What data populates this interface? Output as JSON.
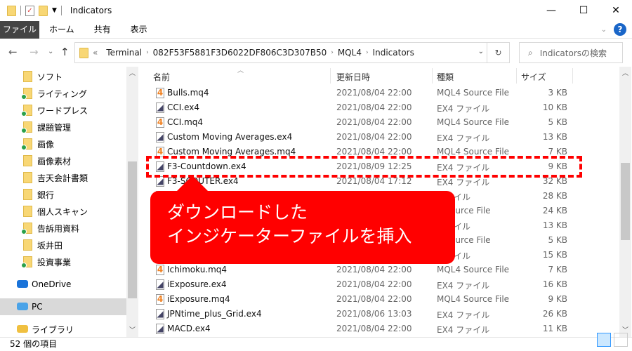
{
  "window": {
    "title": "Indicators",
    "controls": {
      "minimize": "—",
      "maximize": "☐",
      "close": "✕"
    }
  },
  "ribbon": {
    "tabs": [
      "ファイル",
      "ホーム",
      "共有",
      "表示"
    ],
    "help_icon": "?"
  },
  "nav": {
    "back": "←",
    "forward": "→",
    "recent": "⌄",
    "up": "↑",
    "breadcrumb": [
      "Terminal",
      "082F53F5881F3D6022DF806C3D307B50",
      "MQL4",
      "Indicators"
    ],
    "overflow": "«",
    "refresh": "↻",
    "search_placeholder": "Indicatorsの検索"
  },
  "sidebar": {
    "items": [
      {
        "label": "ソフト",
        "icon": "folder-icon",
        "sync": false
      },
      {
        "label": "ライティング",
        "icon": "shared-folder-icon",
        "sync": true
      },
      {
        "label": "ワードプレス",
        "icon": "folder-icon",
        "sync": true
      },
      {
        "label": "課題管理",
        "icon": "folder-icon",
        "sync": true
      },
      {
        "label": "画像",
        "icon": "folder-icon",
        "sync": true
      },
      {
        "label": "画像素材",
        "icon": "shared-folder-icon",
        "sync": false
      },
      {
        "label": "吉天会計書類",
        "icon": "folder-icon",
        "sync": false
      },
      {
        "label": "銀行",
        "icon": "folder-icon",
        "sync": false
      },
      {
        "label": "個人スキャン",
        "icon": "folder-icon",
        "sync": false
      },
      {
        "label": "告訴用資料",
        "icon": "folder-icon",
        "sync": true
      },
      {
        "label": "坂井田",
        "icon": "folder-icon",
        "sync": false
      },
      {
        "label": "投資事業",
        "icon": "folder-icon",
        "sync": true
      }
    ],
    "onedrive": "OneDrive",
    "pc": "PC",
    "library": "ライブラリ"
  },
  "columns": {
    "name": "名前",
    "date": "更新日時",
    "type": "種類",
    "size": "サイズ"
  },
  "files": [
    {
      "name": "Bulls.mq4",
      "date": "2021/08/04 22:00",
      "type": "MQL4 Source File",
      "size": "3 KB",
      "kind": "mq"
    },
    {
      "name": "CCI.ex4",
      "date": "2021/08/04 22:00",
      "type": "EX4 ファイル",
      "size": "10 KB",
      "kind": "ex"
    },
    {
      "name": "CCI.mq4",
      "date": "2021/08/04 22:00",
      "type": "MQL4 Source File",
      "size": "5 KB",
      "kind": "mq"
    },
    {
      "name": "Custom Moving Averages.ex4",
      "date": "2021/08/04 22:00",
      "type": "EX4 ファイル",
      "size": "13 KB",
      "kind": "ex"
    },
    {
      "name": "Custom Moving Averages.mq4",
      "date": "2021/08/04 22:00",
      "type": "MQL4 Source File",
      "size": "7 KB",
      "kind": "mq"
    },
    {
      "name": "F3-Countdown.ex4",
      "date": "2021/08/09 12:25",
      "type": "EX4 ファイル",
      "size": "9 KB",
      "kind": "ex"
    },
    {
      "name": "F3-SCOUTER.ex4",
      "date": "2021/08/04 17:12",
      "type": "EX4 ファイル",
      "size": "32 KB",
      "kind": "ex"
    },
    {
      "name": "",
      "date": "",
      "type": "ファイル",
      "size": "28 KB",
      "kind": "ex"
    },
    {
      "name": "",
      "date": "",
      "type": "4 Source File",
      "size": "24 KB",
      "kind": "mq"
    },
    {
      "name": "",
      "date": "",
      "type": "ファイル",
      "size": "13 KB",
      "kind": "ex"
    },
    {
      "name": "",
      "date": "",
      "type": "4 Source File",
      "size": "5 KB",
      "kind": "mq"
    },
    {
      "name": "",
      "date": "",
      "type": "ファイル",
      "size": "15 KB",
      "kind": "ex"
    },
    {
      "name": "Ichimoku.mq4",
      "date": "2021/08/04 22:00",
      "type": "MQL4 Source File",
      "size": "7 KB",
      "kind": "mq"
    },
    {
      "name": "iExposure.ex4",
      "date": "2021/08/04 22:00",
      "type": "EX4 ファイル",
      "size": "16 KB",
      "kind": "ex"
    },
    {
      "name": "iExposure.mq4",
      "date": "2021/08/04 22:00",
      "type": "MQL4 Source File",
      "size": "9 KB",
      "kind": "mq"
    },
    {
      "name": "JPNtime_plus_Grid.ex4",
      "date": "2021/08/06 13:03",
      "type": "EX4 ファイル",
      "size": "26 KB",
      "kind": "ex"
    },
    {
      "name": "MACD.ex4",
      "date": "2021/08/04 22:00",
      "type": "EX4 ファイル",
      "size": "11 KB",
      "kind": "ex"
    }
  ],
  "callout": {
    "line1": "ダウンロードした",
    "line2": "インジケーターファイルを挿入",
    "color": "#ff0000"
  },
  "status": {
    "count": "52 個の項目"
  }
}
